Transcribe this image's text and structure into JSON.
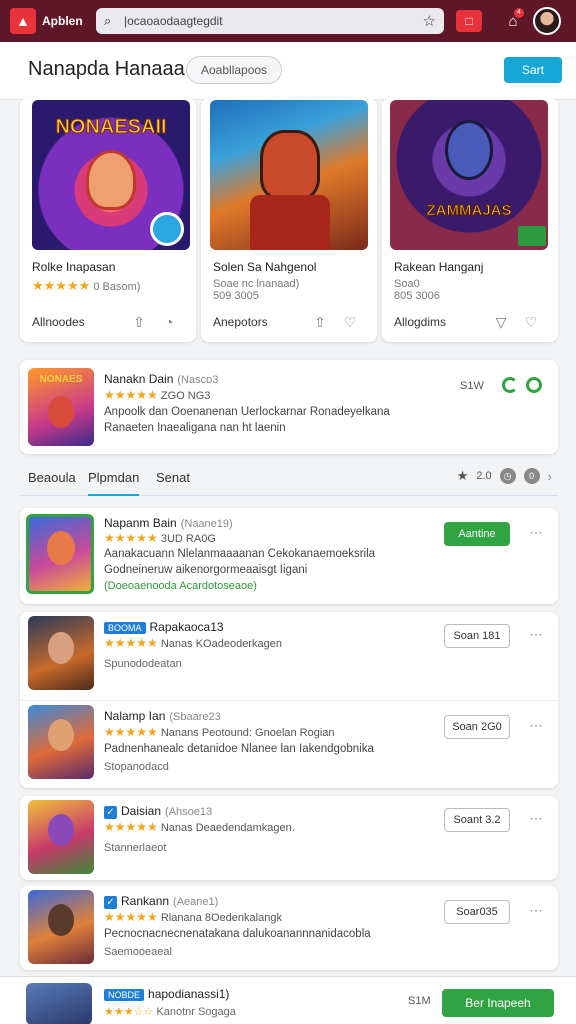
{
  "topbar": {
    "app_name": "Apblen",
    "search_value": "|ocaoaodaagtegdit",
    "icon_red": "□",
    "notif_count": "4"
  },
  "header": {
    "title": "Nanapda Hanaaa",
    "filter_pill": "Aoabllapoos",
    "action_button": "Sart"
  },
  "featured": [
    {
      "art_text": "NONAESAII",
      "name": "Rolke Inapasan",
      "stars": "★★★★★",
      "rating_text": "0 Basom)",
      "footer_label": "Allnoodes"
    },
    {
      "art_text": "",
      "name": "Solen Sa Nahgenol",
      "stars": "",
      "rating_text": "Soae nc lnanaad)",
      "meta": "509 3005",
      "footer_label": "Anepotors"
    },
    {
      "art_text": "ZAMMAJAS",
      "name": "Rakean Hanganj",
      "stars": "",
      "rating_text": "Soa0",
      "meta": "805 3006",
      "footer_label": "Allogdims"
    }
  ],
  "promo": {
    "art_text": "NONAES",
    "title": "Nanakn Dain",
    "subtitle": "(Nasco3",
    "stars": "★★★★★",
    "rating_text": "ZGO NG3",
    "desc": "Anpoolk dan Ooenanenan Uerlockarnar Ronadeyelkana Ranaeten Inaealigana nan ht laenin",
    "right_text": "S1W"
  },
  "tabs": {
    "items": [
      "Beaoula",
      "Plpmdan",
      "Senat"
    ],
    "active_index": 1,
    "right_count": "2.0",
    "circle_label": "0"
  },
  "list": [
    {
      "title": "Napanm Bain",
      "subtitle": "(Naane19)",
      "stars": "★★★★★",
      "rating_text": "3UD RA0G",
      "desc": "Aanakacuann Nlelanmaaaanan Cekokanaemoeksrila Godneineruw aikenorgormeaaisgt Iigani",
      "sub": "(Doeoaenooda Acardotoseaoe)",
      "button": "Aantine"
    },
    {
      "tag": "BOOMA",
      "title": "Rapakaoca13",
      "stars": "★★★★★",
      "rating_text": "Nanas KOadeoderkagen",
      "sub": "Spunododeatan",
      "button": "Soan 181"
    },
    {
      "title": "Nalamp Ian",
      "subtitle": "(Sbaare23",
      "stars": "★★★★★",
      "rating_text": "Nanans Peotound: Gnoelan Rogian",
      "desc": "Padnenhanealc detanidoe Nlanee lan Iakendgobnika",
      "sub": "Stopanodacd",
      "button": "Soan 2G0"
    },
    {
      "title": "Daisian",
      "subtitle": "(Ahsoe13",
      "stars": "★★★★★",
      "rating_text": "Nanas Deaedendamkagen.",
      "sub": "Stannerlaeot",
      "button": "Soant 3.2"
    },
    {
      "title": "Rankann",
      "subtitle": "(Aeane1)",
      "stars": "★★★★★",
      "rating_text": "Rlanana 8Oedenkalangk",
      "desc": "Pecnocnacnecnenatakana dalukoanannnanidacobla",
      "sub": "Saemooeaeal",
      "button": "Soar035"
    }
  ],
  "bottom": {
    "tag": "NOBDE",
    "title": "hapodianassi1)",
    "sub": "Kanotnr Sogaga",
    "count": "S1M",
    "button": "Ber Inapeeh"
  },
  "colors": {
    "topbar": "#5d1728",
    "accent": "#17a7d6",
    "green": "#31a343",
    "star": "#f2a51c"
  }
}
